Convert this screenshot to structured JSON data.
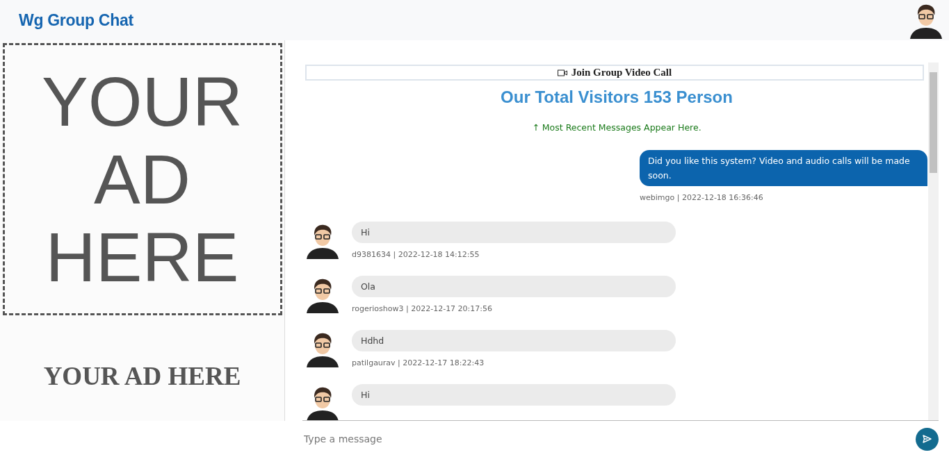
{
  "header": {
    "title": "Wg Group Chat"
  },
  "ad": {
    "big_lines": [
      "YOUR",
      "AD",
      "HERE"
    ],
    "caption": "YOUR AD HERE"
  },
  "chat": {
    "video_button": "Join Group Video Call",
    "visitors": "Our Total Visitors 153 Person",
    "hint": "↑ Most Recent Messages Appear Here.",
    "messages": [
      {
        "kind": "own",
        "text": "Did you like this system? Video and audio calls will be made soon.",
        "meta": "webimgo | 2022-12-18 16:36:46"
      },
      {
        "kind": "other",
        "text": "Hi",
        "meta": "d9381634 | 2022-12-18 14:12:55"
      },
      {
        "kind": "other",
        "text": "Ola",
        "meta": "rogerioshow3 | 2022-12-17 20:17:56"
      },
      {
        "kind": "other",
        "text": "Hdhd",
        "meta": "patilgaurav | 2022-12-17 18:22:43"
      },
      {
        "kind": "other",
        "text": "Hi"
      }
    ]
  },
  "composer": {
    "placeholder": "Type a message"
  }
}
